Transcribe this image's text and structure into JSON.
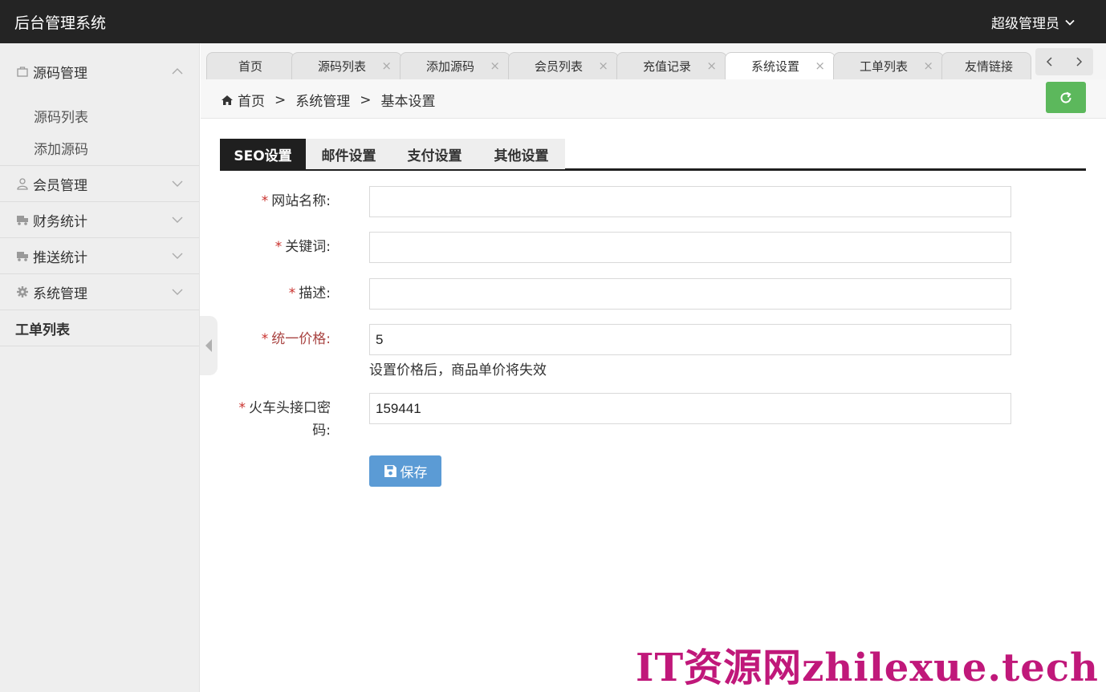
{
  "header": {
    "app_title": "后台管理系统",
    "user_label": "超级管理员"
  },
  "sidebar": {
    "groups": [
      {
        "label": "源码管理",
        "icon": "bag-icon",
        "expanded": true,
        "items": [
          {
            "label": "源码列表"
          },
          {
            "label": "添加源码"
          }
        ]
      },
      {
        "label": "会员管理",
        "icon": "user-icon",
        "expanded": false
      },
      {
        "label": "财务统计",
        "icon": "truck-icon",
        "expanded": false
      },
      {
        "label": "推送统计",
        "icon": "truck-icon",
        "expanded": false
      },
      {
        "label": "系统管理",
        "icon": "gear-icon",
        "expanded": false
      },
      {
        "label": "工单列表",
        "expanded": false
      }
    ]
  },
  "tabs": [
    {
      "label": "首页",
      "closable": false
    },
    {
      "label": "源码列表",
      "closable": true
    },
    {
      "label": "添加源码",
      "closable": true
    },
    {
      "label": "会员列表",
      "closable": true
    },
    {
      "label": "充值记录",
      "closable": true
    },
    {
      "label": "系统设置",
      "closable": true,
      "active": true
    },
    {
      "label": "工单列表",
      "closable": true
    },
    {
      "label": "友情链接",
      "closable": true
    }
  ],
  "tab_close_glyph": "×",
  "breadcrumb": {
    "items": [
      "首页",
      "系统管理",
      "基本设置"
    ],
    "separator": ">"
  },
  "content_tabs": [
    {
      "label": "SEO设置",
      "active": true
    },
    {
      "label": "邮件设置"
    },
    {
      "label": "支付设置"
    },
    {
      "label": "其他设置"
    }
  ],
  "form": {
    "required_mark": "*",
    "fields": [
      {
        "label": "网站名称:",
        "value": ""
      },
      {
        "label": "关键词:",
        "value": ""
      },
      {
        "label": "描述:",
        "value": ""
      },
      {
        "label": "统一价格:",
        "value": "5",
        "hint": "设置价格后，商品单价将失效"
      },
      {
        "label_line1": "火车头接口密",
        "label_line2": "码:",
        "value": "159441"
      }
    ],
    "save_label": "保存"
  },
  "watermark": "IT资源网zhilexue.tech",
  "colors": {
    "header_bg": "#242424",
    "refresh_green": "#5cb85c",
    "save_blue": "#5b9bd5",
    "required_red": "#c9302c",
    "watermark": "#c0187a"
  }
}
